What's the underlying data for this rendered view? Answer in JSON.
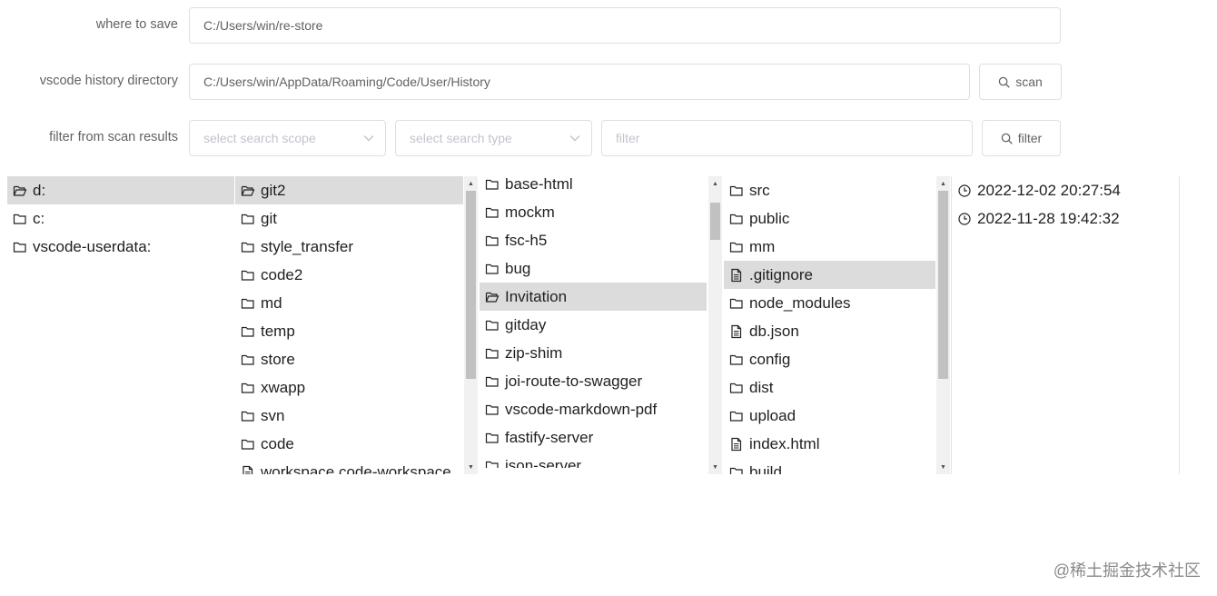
{
  "form": {
    "save": {
      "label": "where to save",
      "value": "C:/Users/win/re-store"
    },
    "history": {
      "label": "vscode history directory",
      "value": "C:/Users/win/AppData/Roaming/Code/User/History",
      "scan_label": "scan"
    },
    "filter": {
      "label": "filter from scan results",
      "scope_placeholder": "select search scope",
      "type_placeholder": "select search type",
      "filter_placeholder": "filter",
      "filter_button_label": "filter"
    }
  },
  "columns": [
    {
      "items": [
        {
          "name": "d:",
          "kind": "folder-open",
          "selected": true
        },
        {
          "name": "c:",
          "kind": "folder"
        },
        {
          "name": "vscode-userdata:",
          "kind": "folder"
        }
      ]
    },
    {
      "items": [
        {
          "name": "git2",
          "kind": "folder-open",
          "selected": true
        },
        {
          "name": "git",
          "kind": "folder"
        },
        {
          "name": "style_transfer",
          "kind": "folder"
        },
        {
          "name": "code2",
          "kind": "folder"
        },
        {
          "name": "md",
          "kind": "folder"
        },
        {
          "name": "temp",
          "kind": "folder"
        },
        {
          "name": "store",
          "kind": "folder"
        },
        {
          "name": "xwapp",
          "kind": "folder"
        },
        {
          "name": "svn",
          "kind": "folder"
        },
        {
          "name": "code",
          "kind": "folder"
        },
        {
          "name": "workspace.code-workspace",
          "kind": "file"
        }
      ]
    },
    {
      "items": [
        {
          "name": "base-html",
          "kind": "folder"
        },
        {
          "name": "mockm",
          "kind": "folder"
        },
        {
          "name": "fsc-h5",
          "kind": "folder"
        },
        {
          "name": "bug",
          "kind": "folder"
        },
        {
          "name": "Invitation",
          "kind": "folder-open",
          "selected": true
        },
        {
          "name": "gitday",
          "kind": "folder"
        },
        {
          "name": "zip-shim",
          "kind": "folder"
        },
        {
          "name": "joi-route-to-swagger",
          "kind": "folder"
        },
        {
          "name": "vscode-markdown-pdf",
          "kind": "folder"
        },
        {
          "name": "fastify-server",
          "kind": "folder"
        },
        {
          "name": "json-server",
          "kind": "folder"
        }
      ]
    },
    {
      "items": [
        {
          "name": "src",
          "kind": "folder"
        },
        {
          "name": "public",
          "kind": "folder"
        },
        {
          "name": "mm",
          "kind": "folder"
        },
        {
          "name": ".gitignore",
          "kind": "file",
          "selected": true
        },
        {
          "name": "node_modules",
          "kind": "folder"
        },
        {
          "name": "db.json",
          "kind": "file"
        },
        {
          "name": "config",
          "kind": "folder"
        },
        {
          "name": "dist",
          "kind": "folder"
        },
        {
          "name": "upload",
          "kind": "folder"
        },
        {
          "name": "index.html",
          "kind": "file"
        },
        {
          "name": "build",
          "kind": "folder"
        }
      ]
    },
    {
      "items": [
        {
          "name": "2022-12-02 20:27:54",
          "kind": "clock"
        },
        {
          "name": "2022-11-28 19:42:32",
          "kind": "clock"
        }
      ]
    }
  ],
  "icons": {
    "search": "search-icon",
    "chevron": "chevron-down-icon",
    "folder": "folder-icon",
    "folder_open": "folder-open-icon",
    "file": "file-icon",
    "clock": "clock-icon"
  },
  "scrollbars": [
    {
      "column": 1,
      "position": 0.0,
      "visible_fraction": 0.7
    },
    {
      "column": 2,
      "position": 0.05,
      "visible_fraction": 0.14
    },
    {
      "column": 3,
      "position": 0.0,
      "visible_fraction": 0.7
    }
  ],
  "watermark": "@稀土掘金技术社区"
}
